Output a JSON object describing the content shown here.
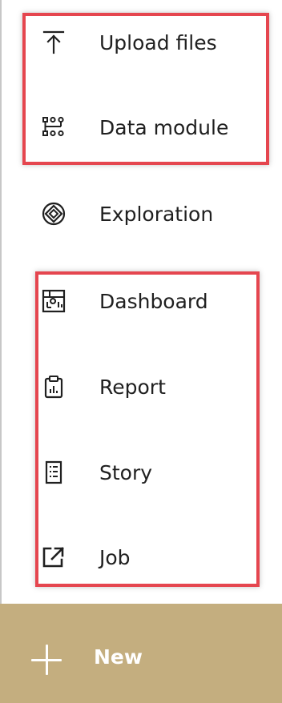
{
  "menu": {
    "items": [
      {
        "label": "Upload files",
        "icon": "upload-icon"
      },
      {
        "label": "Data module",
        "icon": "data-module-icon"
      },
      {
        "label": "Exploration",
        "icon": "exploration-icon"
      },
      {
        "label": "Dashboard",
        "icon": "dashboard-icon"
      },
      {
        "label": "Report",
        "icon": "report-icon"
      },
      {
        "label": "Story",
        "icon": "story-icon"
      },
      {
        "label": "Job",
        "icon": "job-icon"
      }
    ]
  },
  "new_button": {
    "label": "New",
    "icon": "plus-icon"
  },
  "colors": {
    "text": "#202020",
    "highlight": "#e5464f",
    "new_bar": "#c4ae7f",
    "new_text": "#ffffff"
  }
}
